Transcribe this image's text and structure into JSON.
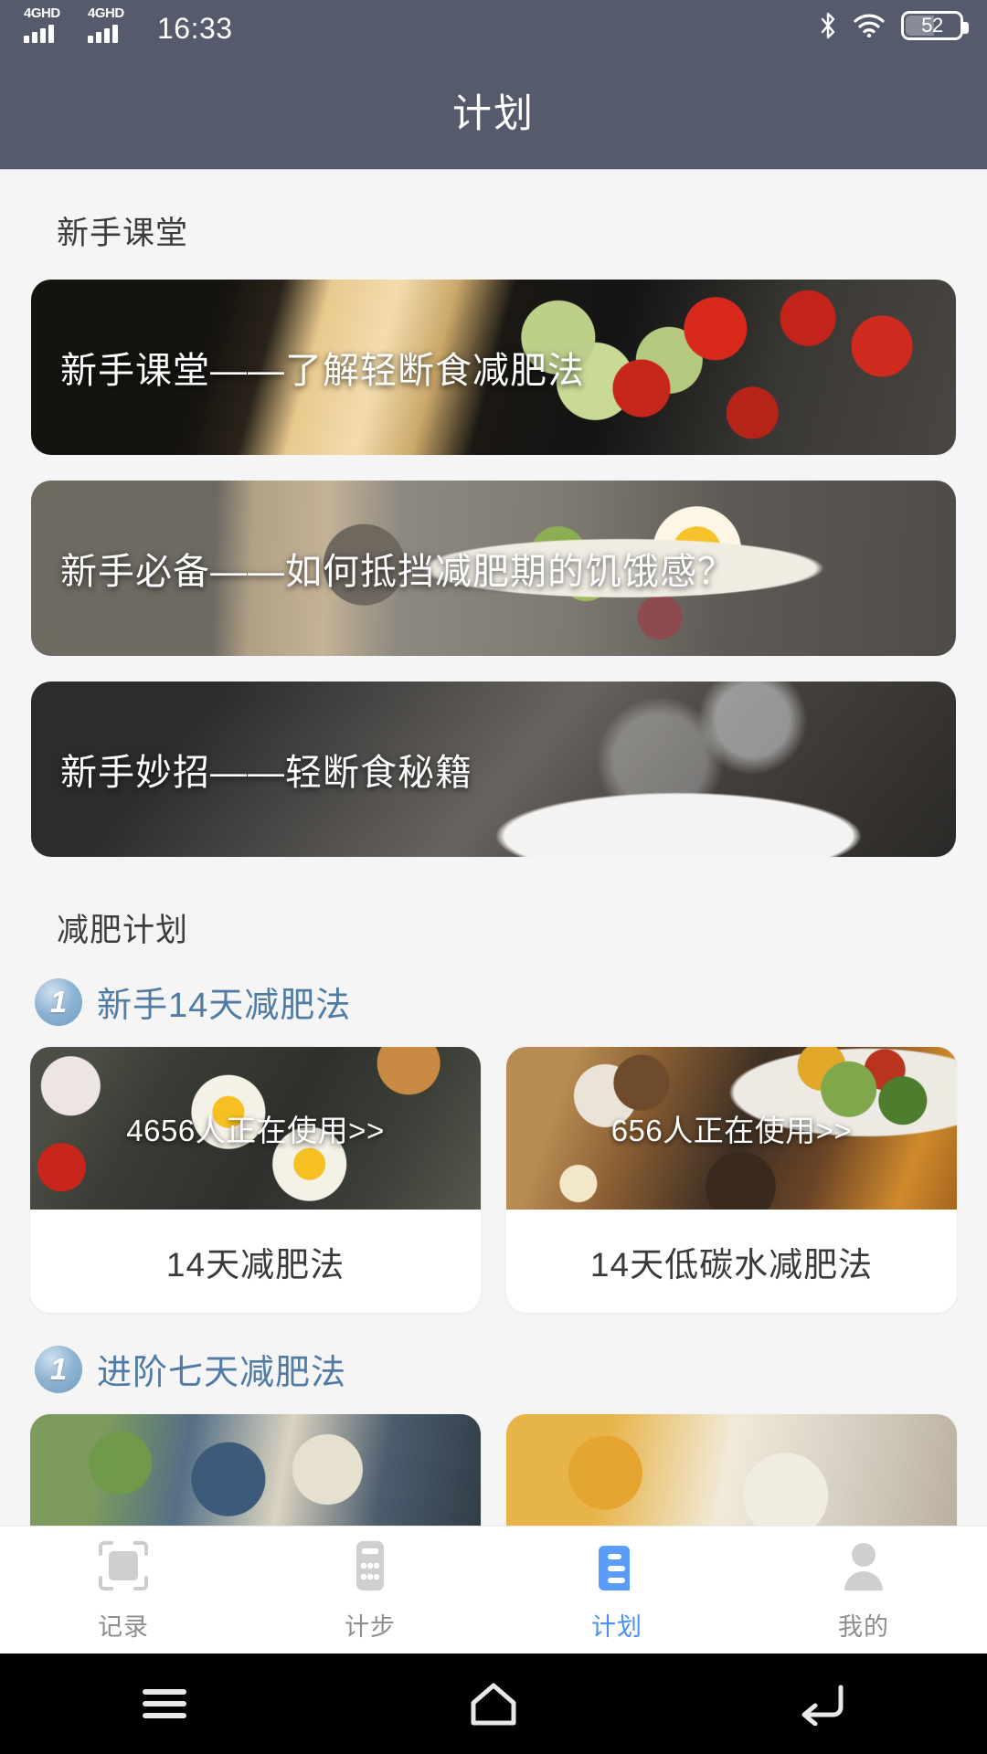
{
  "status_bar": {
    "signal_1": "4GHD",
    "signal_2": "4GHD",
    "time": "16:33",
    "bluetooth_icon": "bluetooth-icon",
    "wifi_icon": "wifi-icon",
    "battery_level": "52"
  },
  "app_bar": {
    "title": "计划"
  },
  "lessons": {
    "section_title": "新手课堂",
    "items": [
      {
        "title": "新手课堂——了解轻断食减肥法"
      },
      {
        "title": "新手必备——如何抵挡减肥期的饥饿感？"
      },
      {
        "title": "新手妙招——轻断食秘籍"
      }
    ]
  },
  "plans": {
    "section_title": "减肥计划",
    "groups": [
      {
        "badge": "1",
        "title": "新手14天减肥法",
        "cards": [
          {
            "users": "4656人正在使用>>",
            "name": "14天减肥法"
          },
          {
            "users": "656人正在使用>>",
            "name": "14天低碳水减肥法"
          }
        ]
      },
      {
        "badge": "1",
        "title": "进阶七天减肥法",
        "cards": [
          {
            "users": "",
            "name": ""
          },
          {
            "users": "",
            "name": ""
          }
        ]
      }
    ]
  },
  "tab_bar": {
    "active_color": "#4a90f0",
    "inactive_color": "#c8c8c8",
    "items": [
      {
        "label": "记录",
        "icon": "scan-record-icon",
        "active": false
      },
      {
        "label": "计步",
        "icon": "pedometer-icon",
        "active": false
      },
      {
        "label": "计划",
        "icon": "plan-document-icon",
        "active": true
      },
      {
        "label": "我的",
        "icon": "person-icon",
        "active": false
      }
    ]
  },
  "system_nav": {
    "menu": "menu-icon",
    "home": "home-icon",
    "back": "back-icon"
  }
}
